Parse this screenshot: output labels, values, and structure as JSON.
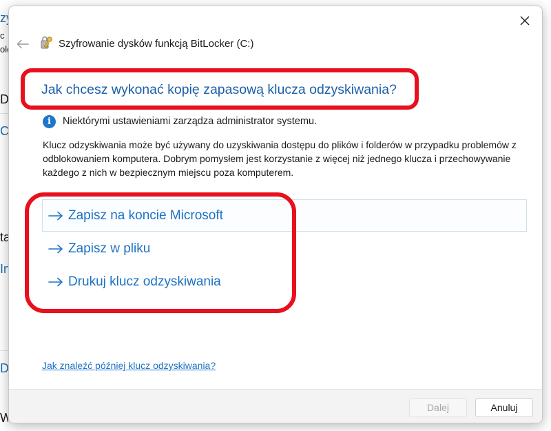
{
  "dialog": {
    "title": "Szyfrowanie dysków funkcją BitLocker (C:)",
    "heading": "Jak chcesz wykonać kopię zapasową klucza odzyskiwania?",
    "info_text": "Niektórymi ustawieniami zarządza administrator systemu.",
    "description": "Klucz odzyskiwania może być używany do uzyskiwania dostępu do plików i folderów w przypadku problemów z odblokowaniem komputera. Dobrym pomysłem jest korzystanie z więcej niż jednego klucza i przechowywanie każdego z nich w bezpiecznym miejscu poza komputerem.",
    "options": [
      {
        "label": "Zapisz na koncie Microsoft"
      },
      {
        "label": "Zapisz w pliku"
      },
      {
        "label": "Drukuj klucz odzyskiwania"
      }
    ],
    "help_link": "Jak znaleźć później klucz odzyskiwania?",
    "buttons": {
      "next": "Dalej",
      "cancel": "Anuluj"
    }
  },
  "background_fragments": [
    "zy",
    "c",
    "olo",
    "Dy",
    "C",
    "ta",
    "In",
    "D",
    "Wy"
  ],
  "colors": {
    "accent": "#1d72c4",
    "heading": "#1c5fa8",
    "annotation": "#e8101d",
    "info": "#1d76c9"
  },
  "icons": [
    "close-icon",
    "back-arrow-icon",
    "bitlocker-key-icon",
    "info-icon",
    "arrow-right-icon"
  ]
}
